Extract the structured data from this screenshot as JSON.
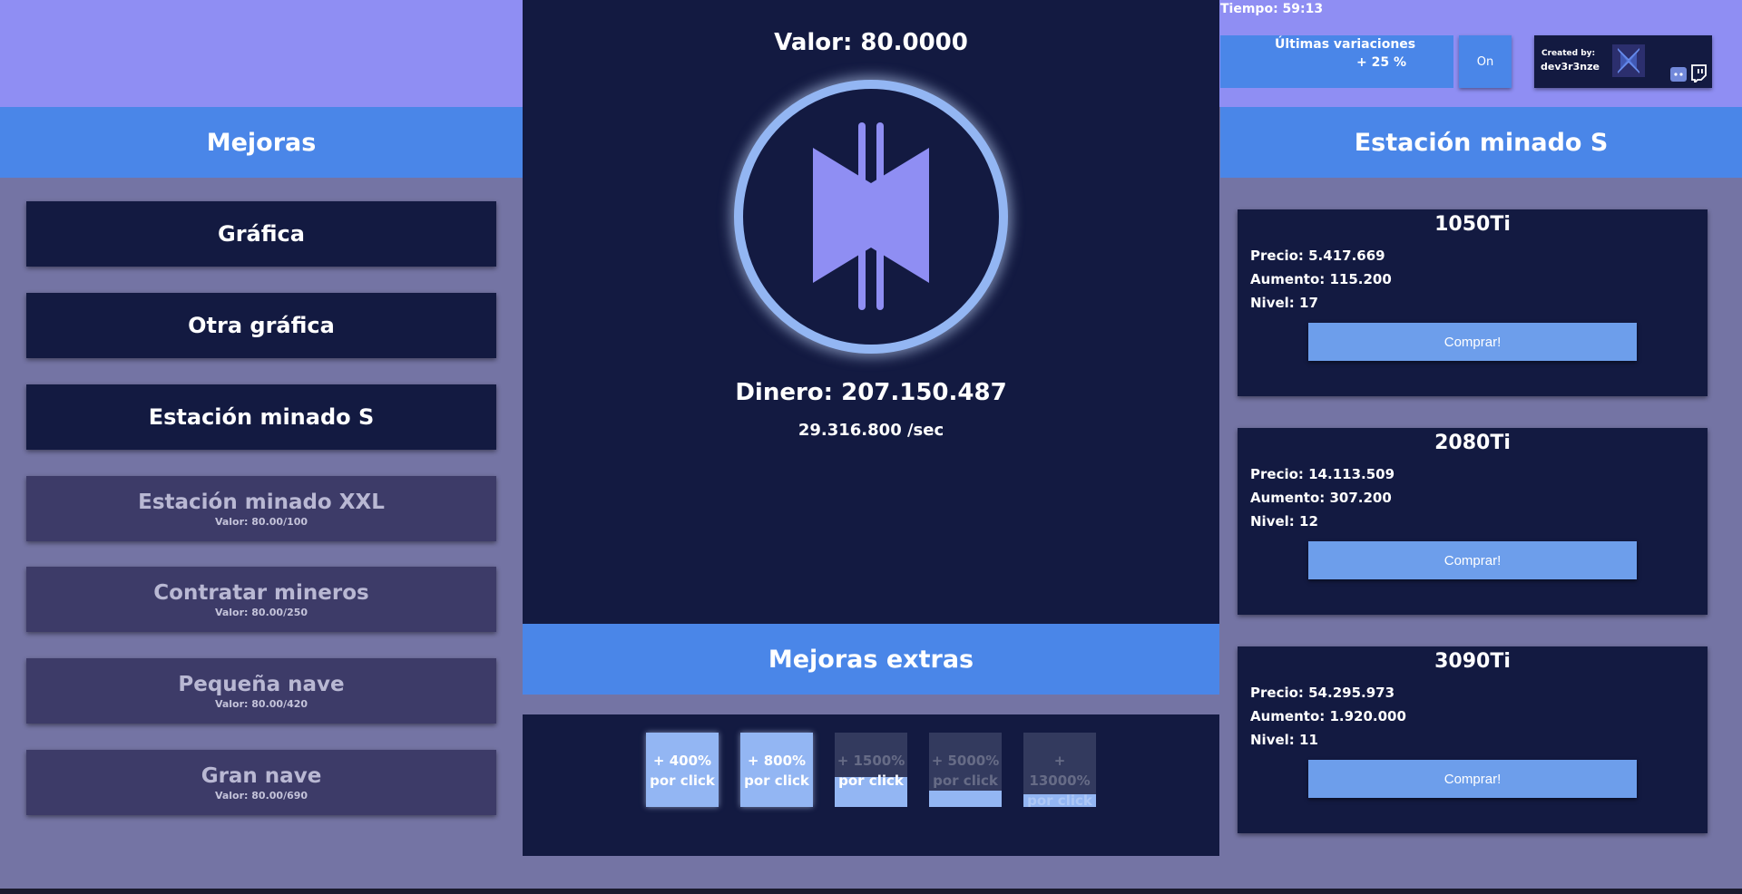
{
  "status": {
    "tiempo": "Tiempo: 59:13"
  },
  "variaciones": {
    "label": "Últimas variaciones",
    "value": "+ 25 %"
  },
  "toggle": {
    "label": "On"
  },
  "credits": {
    "label": "Created by:",
    "author": "dev3r3nze",
    "icons": [
      "logo-icon",
      "discord-icon",
      "twitch-icon"
    ]
  },
  "left_panel": {
    "title": "Mejoras",
    "items": [
      {
        "label": "Gráfica",
        "sub": "",
        "locked": false
      },
      {
        "label": "Otra gráfica",
        "sub": "",
        "locked": false
      },
      {
        "label": "Estación minado S",
        "sub": "",
        "locked": false
      },
      {
        "label": "Estación minado XXL",
        "sub": "Valor: 80.00/100",
        "locked": true
      },
      {
        "label": "Contratar mineros",
        "sub": "Valor: 80.00/250",
        "locked": true
      },
      {
        "label": "Pequeña nave",
        "sub": "Valor: 80.00/420",
        "locked": true
      },
      {
        "label": "Gran nave",
        "sub": "Valor: 80.00/690",
        "locked": true
      }
    ]
  },
  "center": {
    "valor": "Valor: 80.0000",
    "dinero": "Dinero: 207.150.487",
    "rate": "29.316.800 /sec",
    "coin_icon": "coin-logo-icon"
  },
  "extras": {
    "title": "Mejoras extras",
    "boosts": [
      {
        "line1": "+ 400%",
        "line2": "por click",
        "fill": 1.0
      },
      {
        "line1": "+ 800%",
        "line2": "por click",
        "fill": 1.0
      },
      {
        "line1": "+ 1500%",
        "line2": "por click",
        "fill": 0.4
      },
      {
        "line1": "+ 5000%",
        "line2": "por click",
        "fill": 0.22
      },
      {
        "line1": "+ 13000%",
        "line2": "por click",
        "fill": 0.17
      }
    ]
  },
  "right_panel": {
    "title": "Estación minado S",
    "gpus": [
      {
        "name": "1050Ti",
        "precio": "Precio: 5.417.669",
        "aumento": "Aumento: 115.200",
        "nivel": "Nivel: 17",
        "buy": "Comprar!"
      },
      {
        "name": "2080Ti",
        "precio": "Precio: 14.113.509",
        "aumento": "Aumento: 307.200",
        "nivel": "Nivel: 12",
        "buy": "Comprar!"
      },
      {
        "name": "3090Ti",
        "precio": "Precio: 54.295.973",
        "aumento": "Aumento: 1.920.000",
        "nivel": "Nivel: 11",
        "buy": "Comprar!"
      }
    ]
  },
  "colors": {
    "background": "#7474a4",
    "top_band": "#8f8ef3",
    "header_blue": "#4a86e8",
    "panel_dark": "#131a41",
    "locked_item": "#3d3b68",
    "button_blue": "#6d9eeb",
    "coin_ring": "#93b6f3",
    "coin_symbol": "#8f8ef3"
  }
}
